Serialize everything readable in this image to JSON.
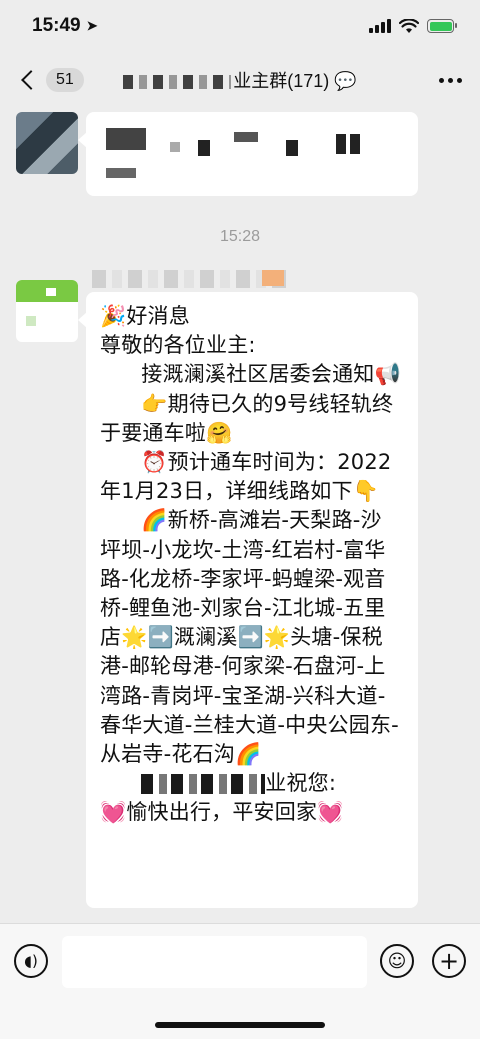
{
  "status_bar": {
    "time": "15:49",
    "location_icon": "location-arrow-icon",
    "signal_icon": "cellular-signal-icon",
    "wifi_icon": "wifi-icon",
    "battery_icon": "battery-charging-icon",
    "battery_color": "#34c759"
  },
  "nav": {
    "unread_count": "51",
    "title_suffix": "业主群(171)",
    "title_icon": "chat-bubble-icon",
    "more_icon": "more-dots-icon"
  },
  "messages": {
    "timestamp": "15:28",
    "notice_lines": [
      "🎉好消息",
      "尊敬的各位业主:",
      "      接溉澜溪社区居委会通知📢",
      "      👉期待已久的9号线轻轨终于要通车啦🤗",
      "      ⏰预计通车时间为：2022年1月23日，详细线路如下👇",
      "      🌈新桥-高滩岩-天梨路-沙坪坝-小龙坎-土湾-红岩村-富华路-化龙桥-李家坪-蚂蝗梁-观音桥-鲤鱼池-刘家台-江北城-五里店🌟➡️溉澜溪➡️🌟头塘-保税港-邮轮母港-何家梁-石盘河-上湾路-青岗坪-宝圣湖-兴科大道-春华大道-兰桂大道-中央公园东-从岩寺-花石沟🌈"
    ],
    "closing_suffix": "业祝您:",
    "closing_line": "💓愉快出行，平安回家💓"
  },
  "input_bar": {
    "voice_icon": "voice-icon",
    "emoji_icon": "emoji-icon",
    "plus_icon": "plus-icon",
    "placeholder": ""
  }
}
